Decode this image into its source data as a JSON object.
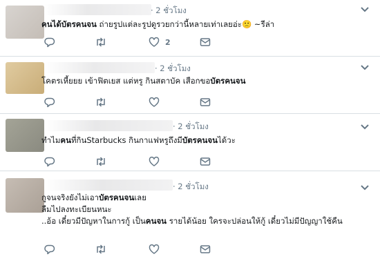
{
  "tweets": [
    {
      "time": "· 2 ชั่วโมง",
      "lines": [
        {
          "parts": [
            {
              "t": "คนได้บัตรคนจน",
              "b": true
            },
            {
              "t": " ถ่ายรูปแต่ละรูปดูรวยกว่านี้หลายเท่าเลยอ่ะ",
              "b": false
            },
            {
              "t": "🙁",
              "b": false
            },
            {
              "t": " ~รีล่า",
              "b": false
            }
          ]
        }
      ],
      "like_count": "2"
    },
    {
      "time": "· 2 ชั่วโมง",
      "lines": [
        {
          "parts": [
            {
              "t": "โคตรเหี้ยยย เข้าฟิตเยส แต่หรู กินสตาบัค เสือกขอ",
              "b": false
            },
            {
              "t": "บัตรคนจน",
              "b": true
            }
          ]
        }
      ],
      "like_count": ""
    },
    {
      "time": "· 2 ชั่วโมง",
      "lines": [
        {
          "parts": [
            {
              "t": "ทำไม",
              "b": false
            },
            {
              "t": "คน",
              "b": true
            },
            {
              "t": "ที่กินStarbucks กินกาแฟหรูถึงมี",
              "b": false
            },
            {
              "t": "บัตรคนจน",
              "b": true
            },
            {
              "t": "ได้วะ",
              "b": false
            }
          ]
        }
      ],
      "like_count": ""
    },
    {
      "time": "· 2 ชั่วโมง",
      "lines": [
        {
          "parts": [
            {
              "t": "กูจนจริงยังไม่เอา",
              "b": false
            },
            {
              "t": "บัตรคนจน",
              "b": true
            },
            {
              "t": "เลย",
              "b": false
            }
          ]
        },
        {
          "parts": [
            {
              "t": "ลืมไปลงทะเบียนหนะ",
              "b": false
            }
          ]
        },
        {
          "parts": [
            {
              "t": "..อ้อ เดี๋ยวมีปัญหาในการกู้ เป็น",
              "b": false
            },
            {
              "t": "คนจน",
              "b": true
            },
            {
              "t": " รายได้น้อย ใครจะปล่อนให้กู้ เดี๋ยวไม่มีปัญญาใช้คืน",
              "b": false
            }
          ]
        }
      ],
      "like_count": ""
    }
  ],
  "icons": {
    "reply": "reply-icon",
    "retweet": "retweet-icon",
    "like": "heart-icon",
    "dm": "envelope-icon",
    "caret": "chevron-down-icon"
  },
  "colors": {
    "icon": "#657786",
    "text": "#14171a",
    "divider": "#d8dee3",
    "avatar_1": "#cdc7c2",
    "avatar_2": "#d2b98a",
    "avatar_3": "#9a9a8e",
    "avatar_4": "#bfb5ac"
  }
}
